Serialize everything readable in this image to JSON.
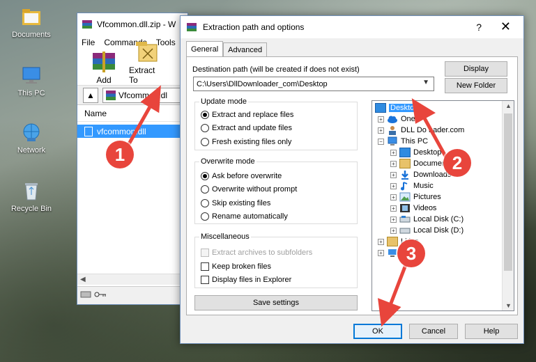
{
  "desktop": {
    "icons": [
      {
        "label": "Documents",
        "icon": "folder-icon"
      },
      {
        "label": "This PC",
        "icon": "computer-icon"
      },
      {
        "label": "Network",
        "icon": "network-icon"
      },
      {
        "label": "Recycle Bin",
        "icon": "recycle-bin-icon"
      }
    ]
  },
  "winrar": {
    "title": "Vfcommon.dll.zip - W",
    "menu": [
      "File",
      "Commands",
      "Tools"
    ],
    "toolbar": {
      "add_label": "Add",
      "extract_label": "Extract To"
    },
    "path_value": "Vfcommon.dl",
    "column_name": "Name",
    "selected_file": "vfcommon.dll"
  },
  "dialog": {
    "title": "Extraction path and options",
    "help_glyph": "?",
    "close_glyph": "✕",
    "tabs": [
      "General",
      "Advanced"
    ],
    "destination_label": "Destination path (will be created if does not exist)",
    "destination_value": "C:\\Users\\DllDownloader_com\\Desktop",
    "display_button": "Display",
    "new_folder_button": "New Folder",
    "update_mode": {
      "title": "Update mode",
      "options": [
        "Extract and replace files",
        "Extract and update files",
        "Fresh existing files only"
      ],
      "selected": 0
    },
    "overwrite_mode": {
      "title": "Overwrite mode",
      "options": [
        "Ask before overwrite",
        "Overwrite without prompt",
        "Skip existing files",
        "Rename automatically"
      ],
      "selected": 0
    },
    "misc": {
      "title": "Miscellaneous",
      "options": [
        "Extract archives to subfolders",
        "Keep broken files",
        "Display files in Explorer"
      ]
    },
    "save_settings_button": "Save settings",
    "tree": [
      {
        "label": "Desktop",
        "selected": true
      },
      {
        "label": "OneD"
      },
      {
        "label": "DLL Do    nader.com"
      },
      {
        "label": "This PC"
      },
      {
        "label": "Desktop"
      },
      {
        "label": "Documen"
      },
      {
        "label": "Downloads"
      },
      {
        "label": "Music"
      },
      {
        "label": "Pictures"
      },
      {
        "label": "Videos"
      },
      {
        "label": "Local Disk (C:)"
      },
      {
        "label": "Local Disk (D:)"
      },
      {
        "label": "Li    ies"
      }
    ],
    "ok_button": "OK",
    "cancel_button": "Cancel",
    "help_button": "Help"
  },
  "annotations": {
    "markers": [
      "1",
      "2",
      "3"
    ],
    "arrow_color": "#e8453c"
  }
}
